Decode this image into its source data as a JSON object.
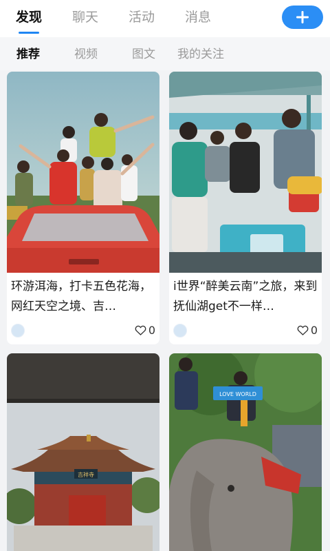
{
  "top_tabs": [
    {
      "label": "发现",
      "active": true
    },
    {
      "label": "聊天",
      "active": false
    },
    {
      "label": "活动",
      "active": false
    },
    {
      "label": "消息",
      "active": false
    }
  ],
  "add_button": {
    "icon": "plus-icon"
  },
  "sub_tabs": [
    {
      "label": "推荐",
      "active": true
    },
    {
      "label": "视频",
      "active": false
    },
    {
      "label": "图文",
      "active": false
    },
    {
      "label": "我的关注",
      "active": false
    }
  ],
  "posts": [
    {
      "title": "环游洱海，打卡五色花海，网红天空之境、吉…",
      "likes": "0"
    },
    {
      "title": "i世界“醉美云南”之旅，来到抚仙湖get不一样…",
      "likes": "0"
    },
    {
      "title": "",
      "likes": ""
    },
    {
      "title": "",
      "likes": ""
    }
  ],
  "photos": {
    "temple_sign": "吉祥寺",
    "banner_text": "LOVE WORLD"
  },
  "colors": {
    "accent": "#1f86f3",
    "add_button": "#2b8ef5",
    "background": "#f2f3f5"
  }
}
